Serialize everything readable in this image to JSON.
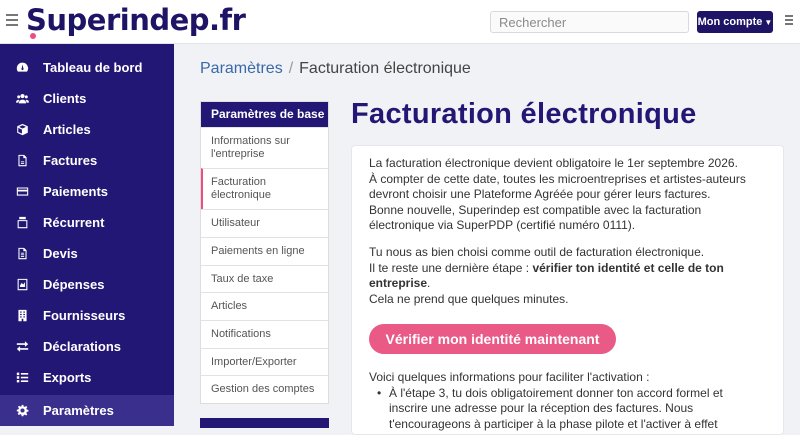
{
  "header": {
    "logo": "Superindep.fr",
    "search_placeholder": "Rechercher",
    "account_label": "Mon compte"
  },
  "sidebar": {
    "items": [
      {
        "label": "Tableau de bord",
        "icon": "dashboard-icon"
      },
      {
        "label": "Clients",
        "icon": "users-icon"
      },
      {
        "label": "Articles",
        "icon": "box-icon"
      },
      {
        "label": "Factures",
        "icon": "invoice-icon"
      },
      {
        "label": "Paiements",
        "icon": "card-icon"
      },
      {
        "label": "Récurrent",
        "icon": "recurring-icon"
      },
      {
        "label": "Devis",
        "icon": "quote-icon"
      },
      {
        "label": "Dépenses",
        "icon": "expense-icon"
      },
      {
        "label": "Fournisseurs",
        "icon": "supplier-icon"
      },
      {
        "label": "Déclarations",
        "icon": "exchange-icon"
      },
      {
        "label": "Exports",
        "icon": "list-icon"
      },
      {
        "label": "Paramètres",
        "icon": "gear-icon",
        "active": true
      }
    ]
  },
  "breadcrumb": {
    "parent": "Paramètres",
    "separator": "/",
    "current": "Facturation électronique"
  },
  "settings_menu": {
    "heading": "Paramètres de base",
    "items": [
      "Informations sur l'entreprise",
      "Facturation électronique",
      "Utilisateur",
      "Paiements en ligne",
      "Taux de taxe",
      "Articles",
      "Notifications",
      "Importer/Exporter",
      "Gestion des comptes"
    ],
    "active_index": 1
  },
  "main": {
    "title": "Facturation électronique",
    "intro_lines": [
      "La facturation électronique devient obligatoire le 1er septembre 2026.",
      "À compter de cette date, toutes les microentreprises et artistes-auteurs",
      "devront choisir une Plateforme Agréée pour gérer leurs factures.",
      "Bonne nouvelle, Superindep est compatible avec la facturation",
      "électronique via SuperPDP (certifié numéro 0111)."
    ],
    "choice_line": "Tu nous as bien choisi comme outil de facturation électronique.",
    "step_prefix": "Il te reste une dernière étape : ",
    "step_bold_1": "vérifier ton identité et celle de ton",
    "step_bold_2": "entreprise",
    "step_suffix": ".",
    "minutes_line": "Cela ne prend que quelques minutes.",
    "cta_label": "Vérifier mon identité maintenant",
    "info_heading": "Voici quelques informations pour faciliter l'activation :",
    "bullet_lines": [
      "À l'étape 3, tu dois obligatoirement donner ton accord formel et",
      "inscrire une adresse pour la réception des factures. Nous",
      "t'encourageons à participer à la phase pilote et l'activer à effet"
    ]
  },
  "colors": {
    "brand": "#221774",
    "accent": "#e95a86",
    "link": "#3a69a8"
  }
}
